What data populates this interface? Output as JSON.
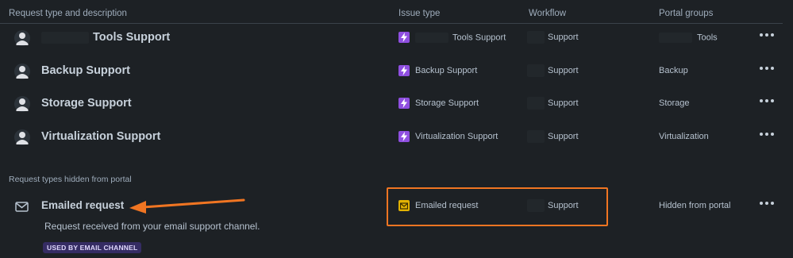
{
  "headers": {
    "request_type": "Request type and description",
    "issue_type": "Issue type",
    "workflow": "Workflow",
    "portal_groups": "Portal groups"
  },
  "rows": [
    {
      "name": "Tools Support",
      "issue_type": "Tools Support",
      "workflow": "Support",
      "portal_group": "Tools",
      "redacted": true
    },
    {
      "name": "Backup Support",
      "issue_type": "Backup Support",
      "workflow": "Support",
      "portal_group": "Backup"
    },
    {
      "name": "Storage Support",
      "issue_type": "Storage Support",
      "workflow": "Support",
      "portal_group": "Storage"
    },
    {
      "name": "Virtualization Support",
      "issue_type": "Virtualization Support",
      "workflow": "Support",
      "portal_group": "Virtualization"
    }
  ],
  "hidden_section": {
    "title": "Request types hidden from portal",
    "item": {
      "name": "Emailed request",
      "description": "Request received from your email support channel.",
      "badge": "USED BY EMAIL CHANNEL",
      "issue_type": "Emailed request",
      "workflow": "Support",
      "portal_group": "Hidden from portal"
    }
  },
  "colors": {
    "background": "#1d2125",
    "issue_type_purple": "#8f4fe0",
    "issue_type_yellow": "#e2b203",
    "annotation_orange": "#f07522",
    "badge_bg": "#352c63"
  },
  "icons": {
    "avatar": "person-avatar-icon",
    "issue_type": "lightning-icon",
    "email": "envelope-icon",
    "more": "more-actions-icon"
  }
}
